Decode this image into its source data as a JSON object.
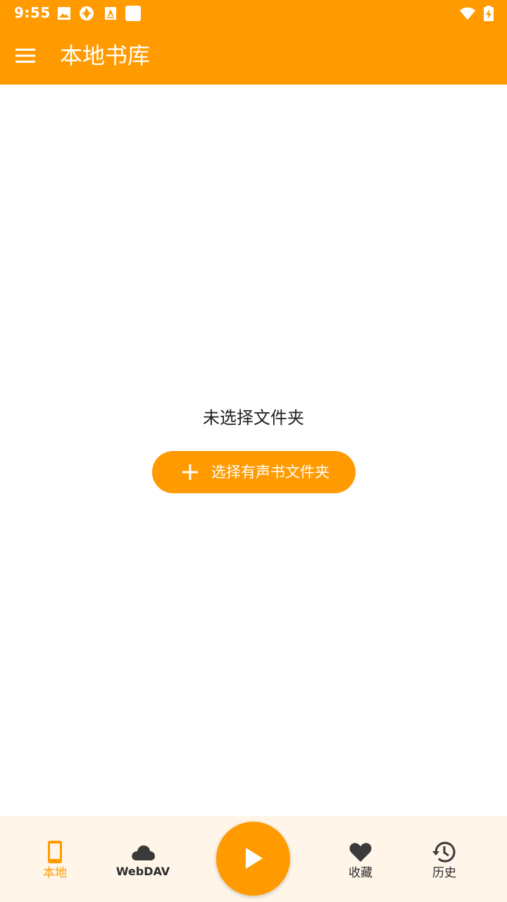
{
  "colors": {
    "primary": "#ff9b00",
    "nav_background": "#fff5e8",
    "text_dark": "#1f1f1f"
  },
  "status_bar": {
    "time": "9:55",
    "icons": [
      "image-icon",
      "sync-icon",
      "app-store-icon",
      "blank-app-icon",
      "wifi-icon",
      "battery-charging-icon"
    ]
  },
  "app_bar": {
    "title": "本地书库",
    "menu_icon": "menu-icon"
  },
  "main": {
    "empty_message": "未选择文件夹",
    "choose_button_label": "选择有声书文件夹",
    "choose_button_icon": "plus-icon"
  },
  "bottom_nav": {
    "items": [
      {
        "label": "本地",
        "icon": "phone-icon",
        "active": true
      },
      {
        "label": "WebDAV",
        "icon": "cloud-icon",
        "active": false
      },
      {
        "label": "收藏",
        "icon": "heart-icon",
        "active": false
      },
      {
        "label": "历史",
        "icon": "history-icon",
        "active": false
      }
    ],
    "play_icon": "play-icon"
  }
}
